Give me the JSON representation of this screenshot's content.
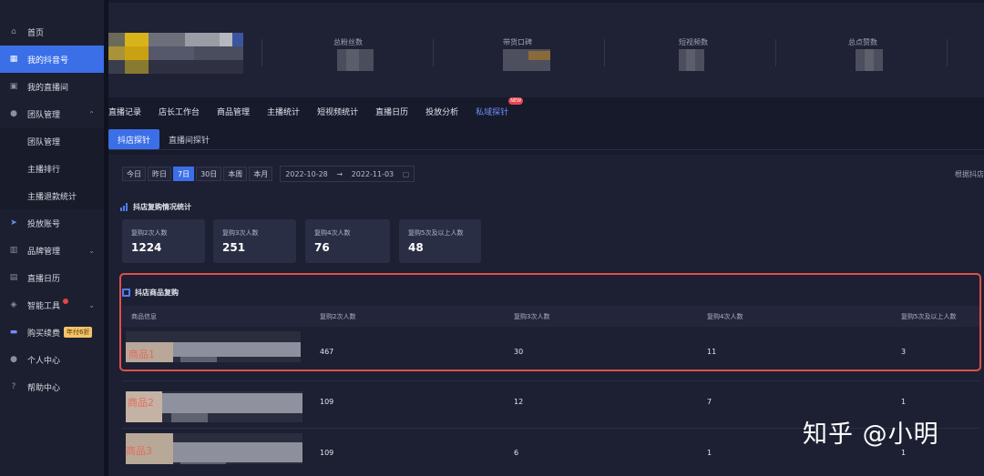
{
  "sidebar": {
    "items": [
      {
        "label": "首页",
        "icon": "home-icon"
      },
      {
        "label": "我的抖音号",
        "icon": "grid-icon",
        "active": true
      },
      {
        "label": "我的直播间",
        "icon": "tv-icon"
      },
      {
        "label": "团队管理",
        "icon": "team-icon",
        "expanded": true
      },
      {
        "label": "团队管理",
        "sub": true
      },
      {
        "label": "主播排行",
        "sub": true
      },
      {
        "label": "主播退款统计",
        "sub": true
      },
      {
        "label": "投放账号",
        "icon": "send-icon"
      },
      {
        "label": "品牌管理",
        "icon": "chart-icon"
      },
      {
        "label": "直播日历",
        "icon": "calendar-icon"
      },
      {
        "label": "智能工具",
        "icon": "tool-icon"
      },
      {
        "label": "购买续费",
        "icon": "card-icon",
        "badge": "年付6折"
      },
      {
        "label": "个人中心",
        "icon": "user-icon"
      },
      {
        "label": "帮助中心",
        "icon": "help-icon"
      }
    ]
  },
  "header": {
    "stats": [
      {
        "label": "总粉丝数"
      },
      {
        "label": "带货口碑"
      },
      {
        "label": "短视频数"
      },
      {
        "label": "总点赞数"
      }
    ]
  },
  "tabs": [
    "直播记录",
    "店长工作台",
    "商品管理",
    "主播统计",
    "短视频统计",
    "直播日历",
    "投放分析",
    "私域探针"
  ],
  "tab_new_badge": "NEW",
  "subtabs": [
    "抖店探针",
    "直播间探针"
  ],
  "date_filters": [
    "今日",
    "昨日",
    "7日",
    "30日",
    "本周",
    "本月"
  ],
  "date_range": {
    "start": "2022-10-28",
    "arrow": "→",
    "end": "2022-11-03"
  },
  "right_link": "根据抖店",
  "repurchase": {
    "title": "抖店复购情况统计",
    "cards": [
      {
        "label": "复购2次人数",
        "value": "1224"
      },
      {
        "label": "复购3次人数",
        "value": "251"
      },
      {
        "label": "复购4次人数",
        "value": "76"
      },
      {
        "label": "复购5次及以上人数",
        "value": "48"
      }
    ]
  },
  "product_table": {
    "title": "抖店商品复购",
    "headers": [
      "商品信息",
      "复购2次人数",
      "复购3次人数",
      "复购4次人数",
      "复购5次及以上人数"
    ],
    "rows": [
      {
        "name": "商品1",
        "c2": "467",
        "c3": "30",
        "c4": "11",
        "c5": "3"
      },
      {
        "name": "商品2",
        "c2": "109",
        "c3": "12",
        "c4": "7",
        "c5": "1"
      },
      {
        "name": "商品3",
        "c2": "109",
        "c3": "6",
        "c4": "1",
        "c5": "1"
      }
    ]
  },
  "watermark": "知乎 @小明"
}
